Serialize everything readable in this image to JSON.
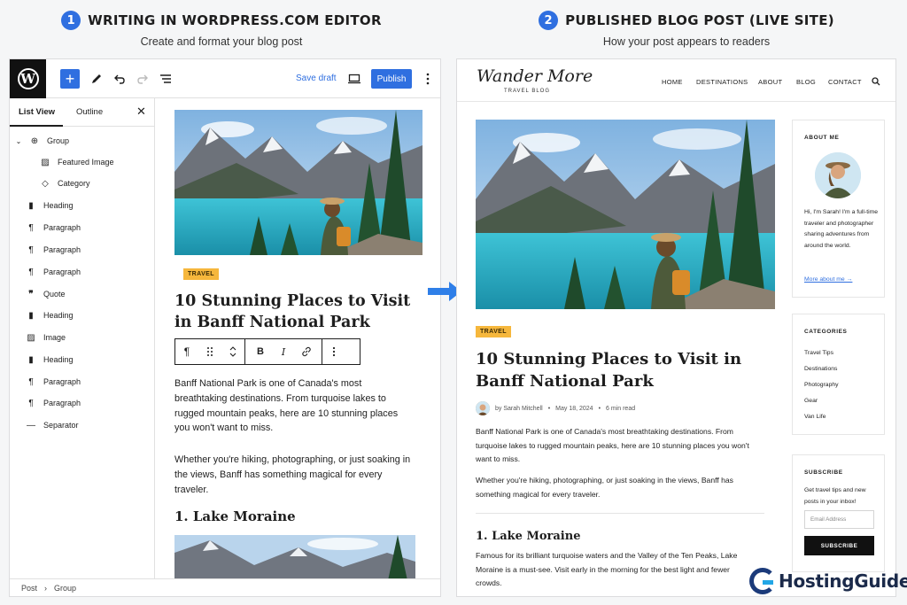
{
  "sections": {
    "left": {
      "number": "1",
      "title": "WRITING IN WORDPRESS.COM EDITOR",
      "subtitle": "Create and format your blog post"
    },
    "right": {
      "number": "2",
      "title": "PUBLISHED BLOG POST (LIVE SITE)",
      "subtitle": "How your post appears to readers"
    }
  },
  "editor": {
    "logo": "W",
    "toolbar": {
      "add": "+",
      "save_draft": "Save draft",
      "publish": "Publish"
    },
    "sidebar": {
      "tabs": [
        "List View",
        "Outline"
      ],
      "close": "✕",
      "items": [
        {
          "label": "Group",
          "icon": "group-icon"
        },
        {
          "label": "Featured Image",
          "icon": "image-icon"
        },
        {
          "label": "Category",
          "icon": "tag-icon"
        },
        {
          "label": "Heading",
          "icon": "bookmark-icon"
        },
        {
          "label": "Paragraph",
          "icon": "pilcrow-icon"
        },
        {
          "label": "Paragraph",
          "icon": "pilcrow-icon"
        },
        {
          "label": "Paragraph",
          "icon": "pilcrow-icon"
        },
        {
          "label": "Quote",
          "icon": "quote-icon"
        },
        {
          "label": "Heading",
          "icon": "bookmark-icon"
        },
        {
          "label": "Image",
          "icon": "image-icon"
        },
        {
          "label": "Heading",
          "icon": "bookmark-icon"
        },
        {
          "label": "Paragraph",
          "icon": "pilcrow-icon"
        },
        {
          "label": "Paragraph",
          "icon": "pilcrow-icon"
        },
        {
          "label": "Separator",
          "icon": "separator-icon"
        }
      ]
    },
    "breadcrumb": [
      "Post",
      "Group"
    ],
    "post": {
      "tag": "TRAVEL",
      "title": "10 Stunning Places to Visit in Banff National Park",
      "paragraphs": [
        "Banff National Park is one of Canada's most breathtaking destinations. From turquoise lakes to rugged mountain peaks, here are 10 stunning places you won't want to miss.",
        "Whether you're hiking, photographing, or just soaking in the views, Banff has something magical for every traveler."
      ],
      "h2": "1. Lake Moraine"
    },
    "block_toolbar": {
      "bold": "B",
      "italic": "I"
    }
  },
  "live": {
    "brand": "Wander More",
    "brand_sub": "TRAVEL BLOG",
    "nav": [
      "HOME",
      "DESTINATIONS",
      "ABOUT",
      "BLOG",
      "CONTACT"
    ],
    "post": {
      "tag": "TRAVEL",
      "title": "10 Stunning Places to Visit in Banff National Park",
      "byline": {
        "author": "by Sarah Mitchell",
        "date": "May 18, 2024",
        "read": "6 min read",
        "sep": "•"
      },
      "paragraphs": [
        "Banff National Park is one of Canada's most breathtaking destinations. From turquoise lakes to rugged mountain peaks, here are 10 stunning places you won't want to miss.",
        "Whether you're hiking, photographing, or just soaking in the views, Banff has something magical for every traveler."
      ],
      "h2": "1. Lake Moraine",
      "h2_para": "Famous for its brilliant turquoise waters and the Valley of the Ten Peaks, Lake Moraine is a must-see. Visit early in the morning for the best light and fewer crowds."
    },
    "about": {
      "title": "ABOUT ME",
      "text": "Hi, I'm Sarah! I'm a full-time traveler and photographer sharing adventures from around the world.",
      "link": "More about me →"
    },
    "categories": {
      "title": "CATEGORIES",
      "items": [
        "Travel Tips",
        "Destinations",
        "Photography",
        "Gear",
        "Van Life"
      ]
    },
    "subscribe": {
      "title": "SUBSCRIBE",
      "text": "Get travel tips and new posts in your inbox!",
      "placeholder": "Email Address",
      "button": "SUBSCRIBE"
    }
  },
  "watermark": "HostingGuider",
  "colors": {
    "accent": "#2f6fe0",
    "tag": "#f6b73c",
    "lake": "#2bb3c8"
  }
}
